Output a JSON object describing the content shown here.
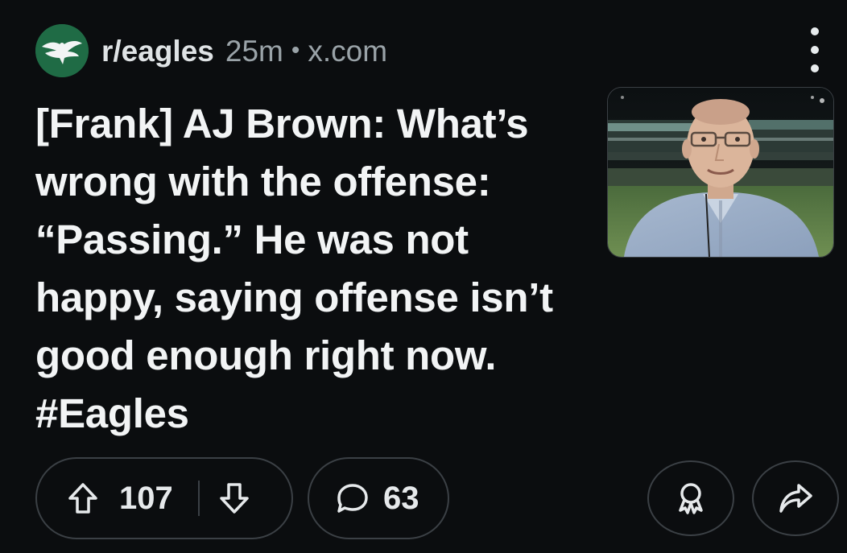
{
  "post": {
    "subreddit": "r/eagles",
    "time": "25m",
    "separator": "•",
    "domain": "x.com",
    "title": "[Frank] AJ Brown: What’s wrong with the offense: “Passing.” He was not happy, saying offense isn’t good enough right now. #Eagles",
    "thumbnail_icon": "man-in-stadium-photo"
  },
  "actions": {
    "upvote_icon": "upvote-arrow-icon",
    "vote_count": "107",
    "downvote_icon": "downvote-arrow-icon",
    "comment_icon": "comment-bubble-icon",
    "comment_count": "63",
    "award_icon": "award-icon",
    "share_icon": "share-arrow-icon"
  },
  "colors": {
    "background": "#0b0d0f",
    "avatar_green": "#1f6b45",
    "text_primary": "#f2f4f5",
    "text_secondary": "#9aa3a8",
    "pill_border": "#3b4045"
  }
}
